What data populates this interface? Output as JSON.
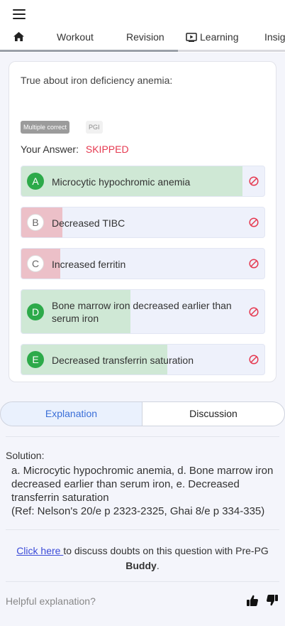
{
  "header": {
    "menu_icon": "hamburger-icon"
  },
  "tabs": [
    {
      "label": "",
      "icon": "home-icon"
    },
    {
      "label": "Workout"
    },
    {
      "label": "Revision"
    },
    {
      "label": "Learning",
      "icon": "play-screen-icon"
    },
    {
      "label": "Insig"
    }
  ],
  "question": {
    "text": "True about iron deficiency anemia:",
    "type_badge": "Multiple correct",
    "source_badge": "PGI",
    "answer_label": "Your Answer:",
    "answer_value": "SKIPPED",
    "options": [
      {
        "letter": "A",
        "text": "Microcytic hypochromic anemia",
        "correct": true,
        "fill_percent": 91
      },
      {
        "letter": "B",
        "text": "Decreased TIBC",
        "correct": false,
        "fill_percent": 17
      },
      {
        "letter": "C",
        "text": "Increased ferritin",
        "correct": false,
        "fill_percent": 16
      },
      {
        "letter": "D",
        "text": "Bone marrow iron decreased earlier than serum iron",
        "correct": true,
        "fill_percent": 45
      },
      {
        "letter": "E",
        "text": "Decreased transferrin saturation",
        "correct": true,
        "fill_percent": 60
      }
    ]
  },
  "segments": {
    "explanation": "Explanation",
    "discussion": "Discussion"
  },
  "solution": {
    "title": "Solution:",
    "body": "a. Microcytic hypochromic anemia, d. Bone marrow iron decreased earlier than serum iron, e. Decreased transferrin saturation",
    "ref": "(Ref: Nelson's 20/e p 2323-2325, Ghai 8/e p 334-335)"
  },
  "discuss": {
    "link": "Click here ",
    "text": "to discuss doubts on this question with Pre-PG ",
    "brand": "Buddy",
    "end": "."
  },
  "feedback": {
    "label": "Helpful explanation?"
  },
  "colors": {
    "correct": "#2daa4a",
    "wrong_fill": "#ecc0c8",
    "skipped": "#e53950",
    "accent": "#3b6fd8"
  }
}
